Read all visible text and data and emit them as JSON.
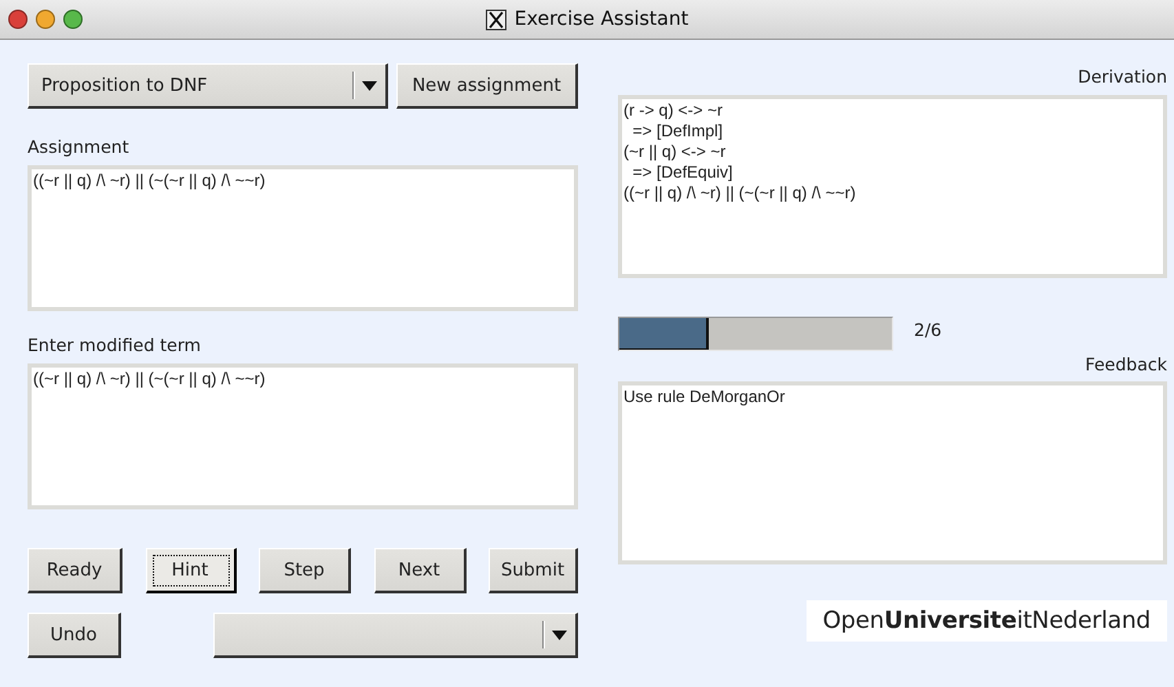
{
  "window": {
    "title": "Exercise Assistant"
  },
  "exercise_dropdown": {
    "value": "Proposition to DNF"
  },
  "new_assignment_button": {
    "label": "New assignment",
    "focused": false
  },
  "assignment": {
    "label": "Assignment",
    "lines": [
      "((~r || q) /\\ ~r) || (~(~r || q) /\\ ~~r)"
    ]
  },
  "modified_term": {
    "label": "Enter modified term",
    "lines": [
      "((~r || q) /\\ ~r) || (~(~r || q) /\\ ~~r)"
    ]
  },
  "buttons": [
    {
      "label": "Ready",
      "focused": false
    },
    {
      "label": "Hint",
      "focused": true
    },
    {
      "label": "Step",
      "focused": false
    },
    {
      "label": "Next",
      "focused": false
    },
    {
      "label": "Submit",
      "focused": false
    }
  ],
  "undo_button": {
    "label": "Undo",
    "focused": false
  },
  "derivation": {
    "label": "Derivation",
    "lines": [
      "(r -> q) <-> ~r",
      "  => [DefImpl]",
      "(~r || q) <-> ~r",
      "  => [DefEquiv]",
      "((~r || q) /\\ ~r) || (~(~r || q) /\\ ~~r)"
    ]
  },
  "progress": {
    "level": 0.33,
    "reading": "2/6"
  },
  "feedback": {
    "label": "Feedback",
    "lines": [
      "Use rule DeMorganOr"
    ]
  },
  "logo": {
    "text": "Open**Universite**itNederland"
  }
}
